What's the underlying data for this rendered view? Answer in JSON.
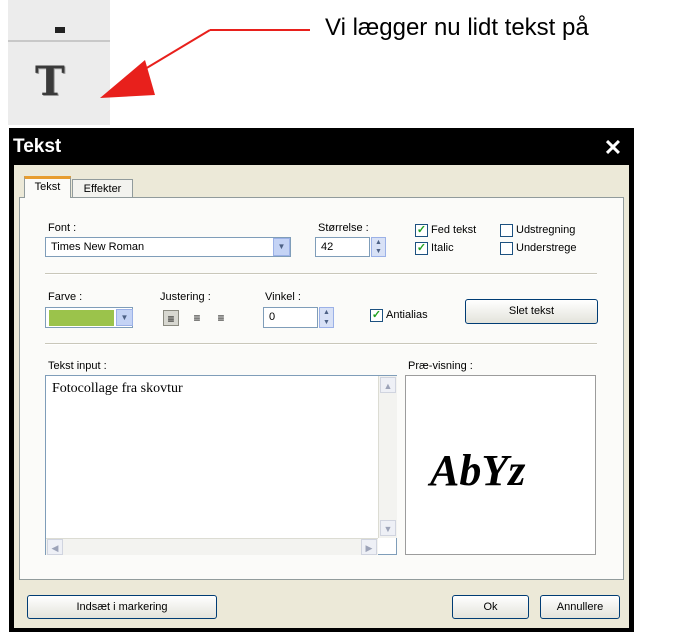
{
  "callout": "Vi lægger nu lidt tekst på",
  "toolbar": {
    "tool_icon": "T"
  },
  "dialog": {
    "title": "Tekst",
    "close_glyph": "✕",
    "tabs": [
      {
        "label": "Tekst",
        "active": true
      },
      {
        "label": "Effekter",
        "active": false
      }
    ],
    "font": {
      "label": "Font :",
      "value": "Times New Roman"
    },
    "size": {
      "label": "Størrelse :",
      "value": "42"
    },
    "checkboxes": {
      "bold": {
        "label": "Fed tekst",
        "checked": true
      },
      "strike": {
        "label": "Udstregning",
        "checked": false
      },
      "italic": {
        "label": "Italic",
        "checked": true
      },
      "underline": {
        "label": "Understrege",
        "checked": false
      },
      "antialias": {
        "label": "Antialias",
        "checked": true
      }
    },
    "color": {
      "label": "Farve :",
      "value": "#9bc34b"
    },
    "alignment": {
      "label": "Justering :",
      "selected": "left"
    },
    "angle": {
      "label": "Vinkel :",
      "value": "0"
    },
    "delete_button": "Slet tekst",
    "text_input": {
      "label": "Tekst input :",
      "value": "Fotocollage fra skovtur"
    },
    "preview": {
      "label": "Præ-visning :",
      "sample": "AbYz"
    },
    "insert_button": "Indsæt i markering",
    "ok_button": "Ok",
    "cancel_button": "Annullere"
  }
}
